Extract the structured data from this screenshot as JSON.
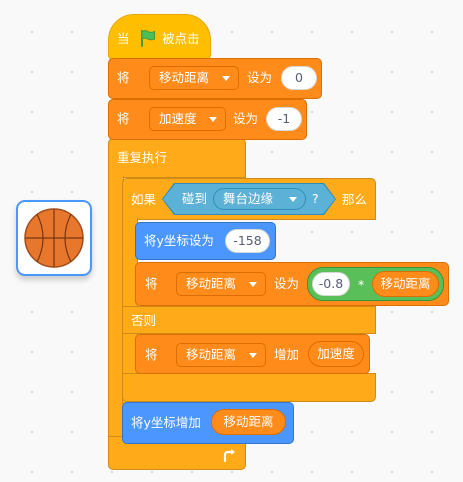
{
  "script": {
    "when_flag": {
      "prefix": "当",
      "suffix": "被点击",
      "flag_icon": "green-flag-icon"
    },
    "set_distance": {
      "prefix": "将",
      "variable": "移动距离",
      "middle": "设为",
      "value": "0"
    },
    "set_accel": {
      "prefix": "将",
      "variable": "加速度",
      "middle": "设为",
      "value": "-1"
    },
    "forever": {
      "label": "重复执行",
      "loop_icon": "loop-arrow-icon"
    },
    "if_else": {
      "if_label": "如果",
      "condition": {
        "prefix": "碰到",
        "target": "舞台边缘",
        "suffix": "?"
      },
      "then_label": "那么",
      "else_label": "否则",
      "then_blocks": {
        "set_y": {
          "label": "将y坐标设为",
          "value": "-158"
        },
        "set_distance": {
          "prefix": "将",
          "variable": "移动距离",
          "middle": "设为",
          "operand": "-0.8",
          "operator": "*",
          "reporter": "移动距离"
        }
      },
      "else_blocks": {
        "change_distance": {
          "prefix": "将",
          "variable": "移动距离",
          "middle": "增加",
          "reporter": "加速度"
        }
      }
    },
    "change_y": {
      "label": "将y坐标增加",
      "reporter": "移动距离"
    }
  },
  "sprite": {
    "icon": "basketball-icon"
  },
  "colors": {
    "events": "#ffbf00",
    "variables": "#ff8c1a",
    "control": "#ffab19",
    "motion": "#4c97ff",
    "sensing": "#5cb1d6",
    "operators": "#59c059",
    "sprite_border": "#4c97ff"
  }
}
